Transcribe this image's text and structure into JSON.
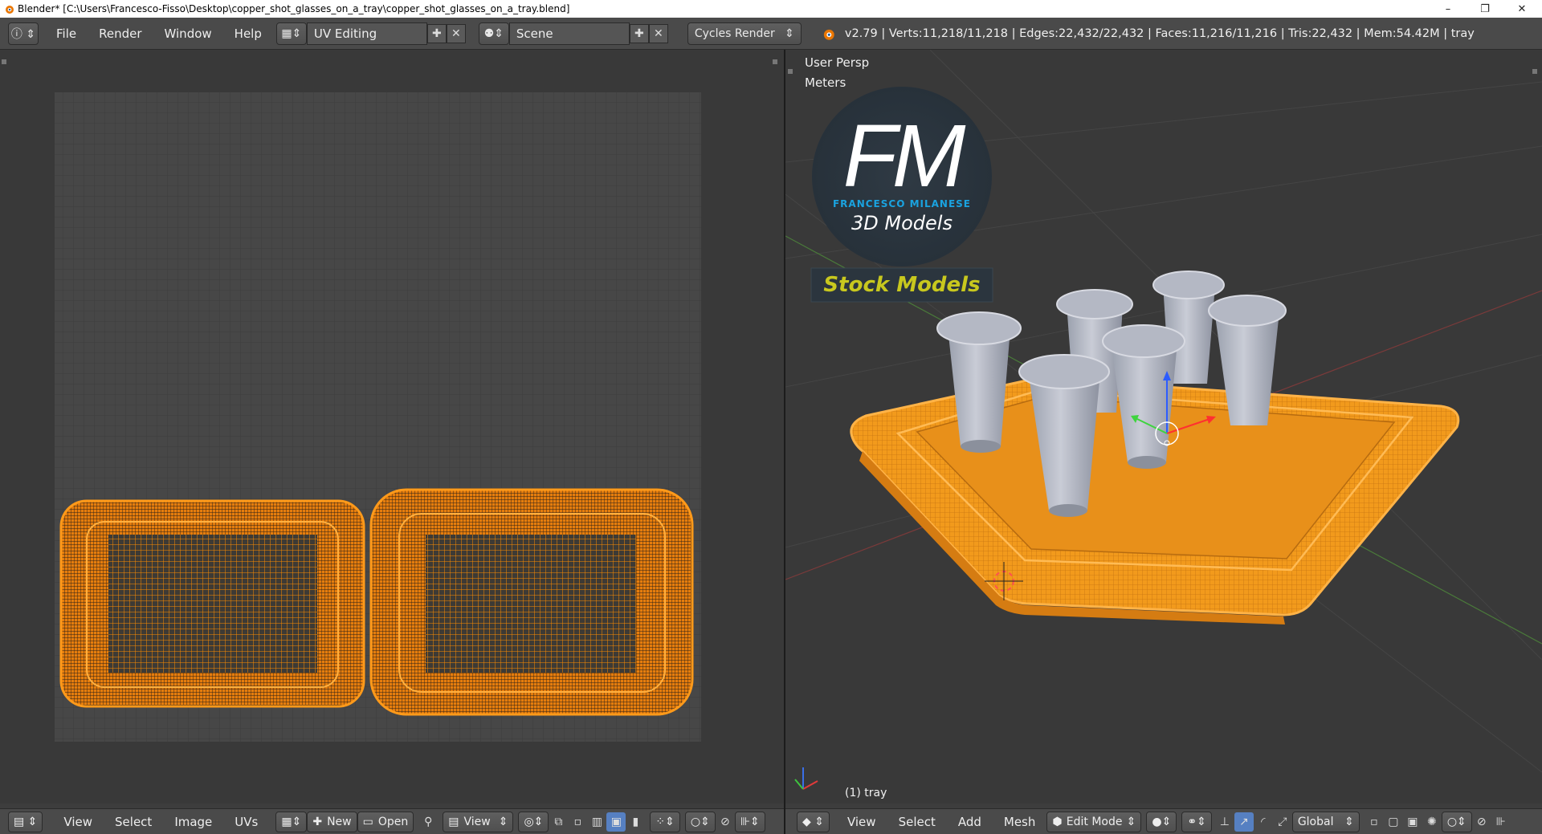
{
  "window": {
    "title": "Blender* [C:\\Users\\Francesco-Fisso\\Desktop\\copper_shot_glasses_on_a_tray\\copper_shot_glasses_on_a_tray.blend]",
    "minimize": "–",
    "restore": "❐",
    "close": "✕"
  },
  "menu": {
    "file": "File",
    "render": "Render",
    "window": "Window",
    "help": "Help"
  },
  "screen_layout": "UV Editing",
  "scene": "Scene",
  "render_engine": "Cycles Render",
  "stats": "v2.79 | Verts:11,218/11,218 | Edges:22,432/22,432 | Faces:11,216/11,216 | Tris:22,432 | Mem:54.42M | tray",
  "uv_editor": {
    "menu": [
      "View",
      "Select",
      "Image",
      "UVs"
    ],
    "new_label": "New",
    "open_label": "Open",
    "view_label": "View"
  },
  "viewport": {
    "view_name": "User Persp",
    "units": "Meters",
    "object_label": "(1) tray",
    "menu": [
      "View",
      "Select",
      "Add",
      "Mesh"
    ],
    "mode": "Edit Mode",
    "orientation": "Global"
  },
  "watermark": {
    "initials": "FM",
    "name": "FRANCESCO MILANESE",
    "subtitle": "3D Models",
    "banner": "Stock Models"
  },
  "colors": {
    "selection": "#ff9a1a",
    "background": "#393939",
    "header": "#4a4a4a",
    "logo_blue": "#1aa3e0",
    "banner_yellow": "#c8c81e"
  }
}
